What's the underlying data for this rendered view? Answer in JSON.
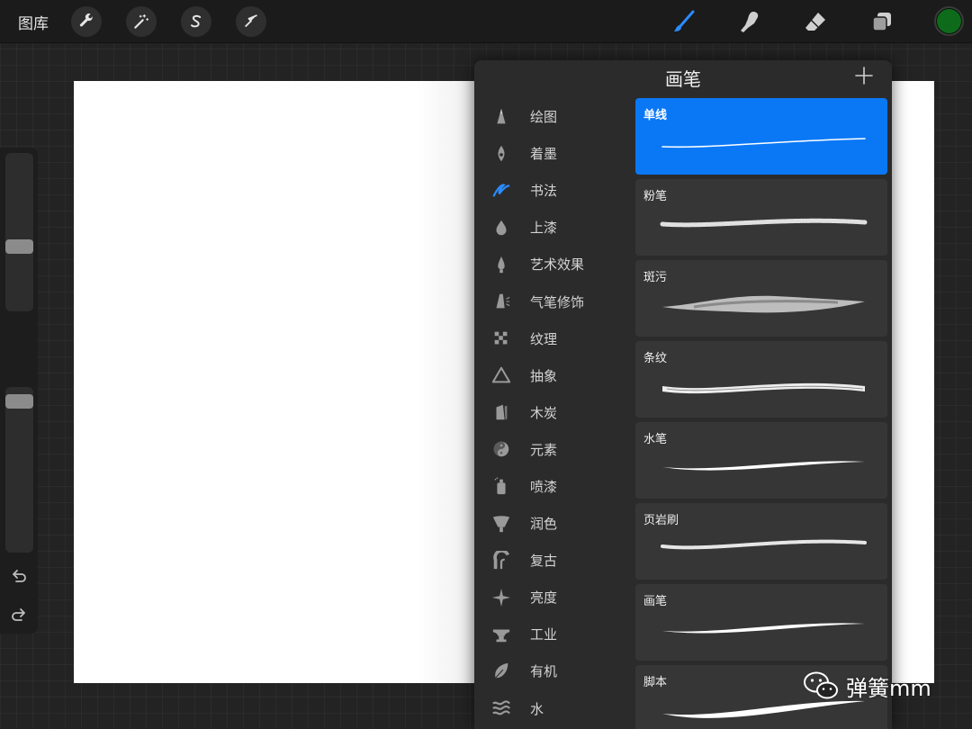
{
  "topbar": {
    "gallery_label": "图库",
    "tools": [
      {
        "name": "actions",
        "icon": "wrench-icon"
      },
      {
        "name": "adjustments",
        "icon": "magic-wand-icon"
      },
      {
        "name": "selection",
        "icon": "selection-s-icon"
      },
      {
        "name": "transform",
        "icon": "arrow-cursor-icon"
      }
    ],
    "right_tools": [
      {
        "name": "paint",
        "icon": "brush-icon",
        "active": true
      },
      {
        "name": "smudge",
        "icon": "smudge-finger-icon"
      },
      {
        "name": "eraser",
        "icon": "eraser-icon"
      },
      {
        "name": "layers",
        "icon": "layers-icon"
      }
    ],
    "current_color": "#0f6b1c"
  },
  "colors": {
    "accent": "#0a78f5",
    "panel_bg": "#2b2b2b",
    "card_bg": "#363636"
  },
  "sidebar": {
    "brush_size_level": 0.4,
    "opacity_level": 0.95,
    "icons": [
      "modify-square-icon",
      "undo-icon",
      "redo-icon"
    ]
  },
  "brush_panel": {
    "title": "画笔",
    "add_icon": "plus-icon",
    "categories": [
      {
        "label": "绘图",
        "icon": "pencil-tip-icon"
      },
      {
        "label": "着墨",
        "icon": "ink-nib-icon"
      },
      {
        "label": "书法",
        "icon": "calligraphy-icon",
        "active": true
      },
      {
        "label": "上漆",
        "icon": "paint-drop-icon"
      },
      {
        "label": "艺术效果",
        "icon": "art-drop-icon"
      },
      {
        "label": "气笔修饰",
        "icon": "airbrush-icon"
      },
      {
        "label": "纹理",
        "icon": "checker-texture-icon"
      },
      {
        "label": "抽象",
        "icon": "triangle-icon"
      },
      {
        "label": "木炭",
        "icon": "charcoal-icon"
      },
      {
        "label": "元素",
        "icon": "yin-yang-icon"
      },
      {
        "label": "喷漆",
        "icon": "spray-can-icon"
      },
      {
        "label": "润色",
        "icon": "fan-brush-icon"
      },
      {
        "label": "复古",
        "icon": "retro-arc-icon"
      },
      {
        "label": "亮度",
        "icon": "sparkle-icon"
      },
      {
        "label": "工业",
        "icon": "anvil-icon"
      },
      {
        "label": "有机",
        "icon": "leaf-icon"
      },
      {
        "label": "水",
        "icon": "waves-icon"
      }
    ],
    "brushes": [
      {
        "name": "单线",
        "selected": true,
        "style": "thin"
      },
      {
        "name": "粉笔",
        "style": "chalk"
      },
      {
        "name": "斑污",
        "style": "smudge"
      },
      {
        "name": "条纹",
        "style": "streaks"
      },
      {
        "name": "水笔",
        "style": "smooth"
      },
      {
        "name": "页岩刷",
        "style": "shale"
      },
      {
        "name": "画笔",
        "style": "smooth"
      },
      {
        "name": "脚本",
        "style": "thick"
      }
    ]
  },
  "watermark": {
    "text": "弹簧mm",
    "icon": "wechat-icon"
  }
}
